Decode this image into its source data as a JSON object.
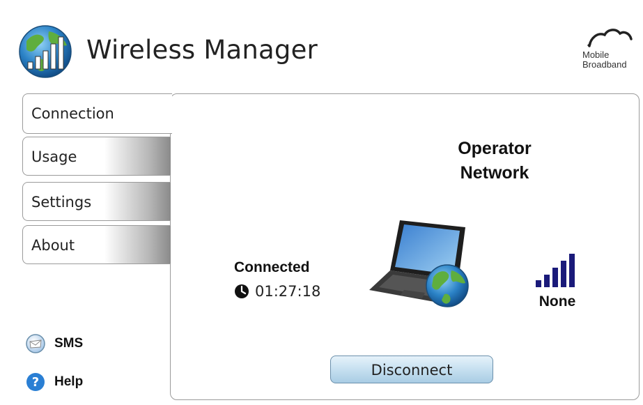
{
  "app": {
    "title": "Wireless Manager",
    "brand_line1": "Mobile",
    "brand_line2": "Broadband"
  },
  "tabs": [
    {
      "label": "Connection",
      "active": true
    },
    {
      "label": "Usage",
      "active": false
    },
    {
      "label": "Settings",
      "active": false
    },
    {
      "label": "About",
      "active": false
    }
  ],
  "side_links": {
    "sms": "SMS",
    "help": "Help"
  },
  "connection": {
    "network_line1": "Operator",
    "network_line2": "Network",
    "status": "Connected",
    "elapsed": "01:27:18",
    "signal_label": "None",
    "disconnect_label": "Disconnect"
  },
  "icons": {
    "app_logo": "globe-signal-icon",
    "brand": "cloud-icon",
    "laptop": "laptop-globe-icon",
    "clock": "clock-icon",
    "signal": "signal-bars-icon",
    "sms": "sms-icon",
    "help": "help-icon"
  },
  "colors": {
    "signal_bars": "#1a1a7a",
    "button_fill": "#c6e0f0",
    "help_blue": "#2a7fd4"
  }
}
